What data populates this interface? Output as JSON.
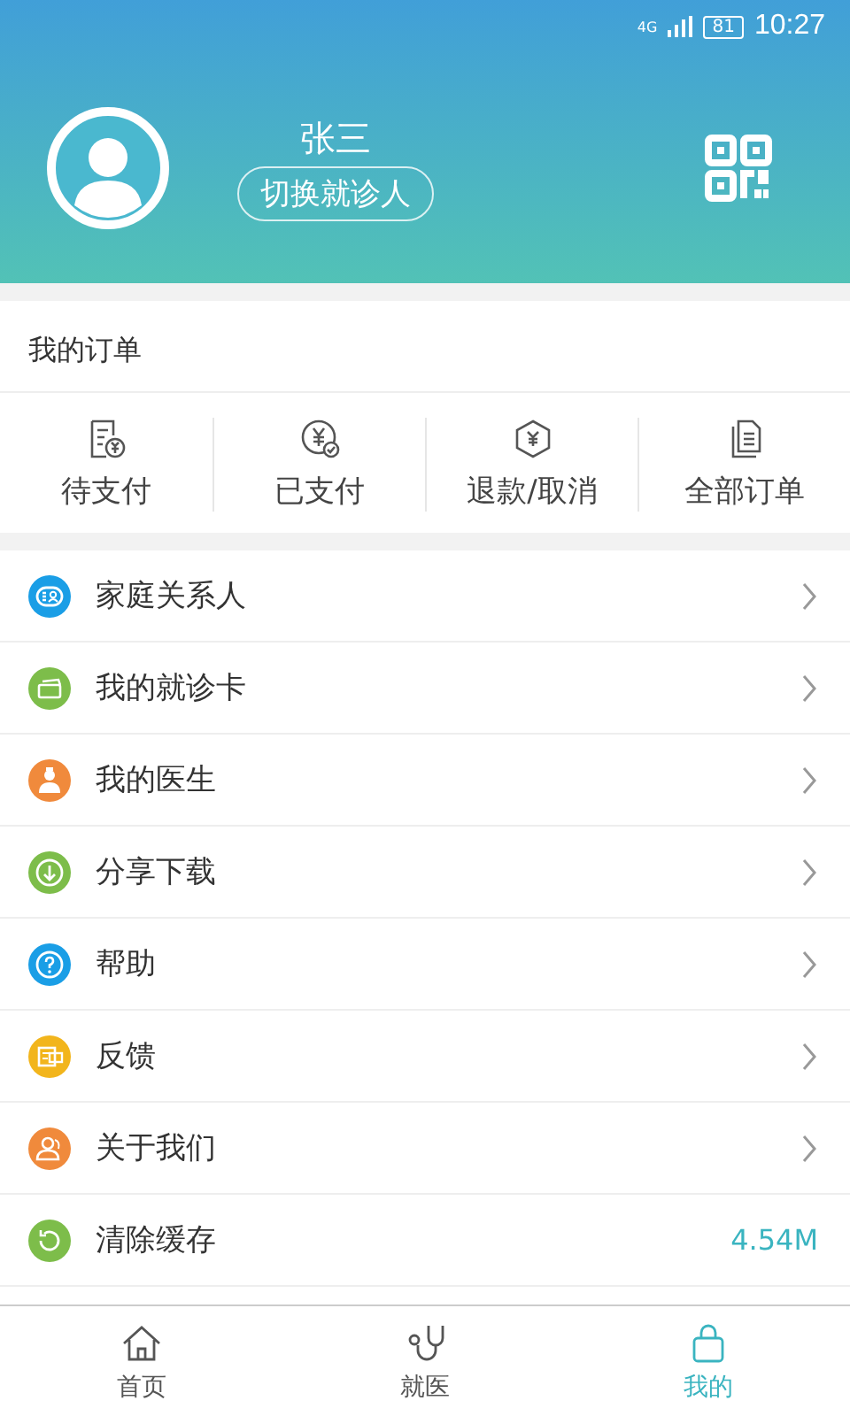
{
  "status_bar": {
    "network": "4G",
    "battery": "81",
    "time": "10:27"
  },
  "profile": {
    "name": "张三",
    "switch_button": "切换就诊人"
  },
  "orders": {
    "title": "我的订单",
    "items": [
      {
        "kind": "pending",
        "label": "待支付"
      },
      {
        "kind": "paid",
        "label": "已支付"
      },
      {
        "kind": "refund",
        "label": "退款/取消"
      },
      {
        "kind": "all",
        "label": "全部订单"
      }
    ]
  },
  "menu": [
    {
      "kind": "family",
      "label": "家庭关系人",
      "color": "#1a9ee6"
    },
    {
      "kind": "card",
      "label": "我的就诊卡",
      "color": "#7dbd4a"
    },
    {
      "kind": "doctor",
      "label": "我的医生",
      "color": "#f08a3c"
    },
    {
      "kind": "download",
      "label": "分享下载",
      "color": "#7dbd4a"
    },
    {
      "kind": "help",
      "label": "帮助",
      "color": "#1a9ee6"
    },
    {
      "kind": "feedback",
      "label": "反馈",
      "color": "#f2b51c"
    },
    {
      "kind": "about",
      "label": "关于我们",
      "color": "#f08a3c"
    },
    {
      "kind": "cache",
      "label": "清除缓存",
      "color": "#7dbd4a",
      "value": "4.54M"
    }
  ],
  "tab_bar": [
    {
      "kind": "home",
      "label": "首页",
      "selected": false
    },
    {
      "kind": "medical",
      "label": "就医",
      "selected": false
    },
    {
      "kind": "mine",
      "label": "我的",
      "selected": true
    }
  ]
}
